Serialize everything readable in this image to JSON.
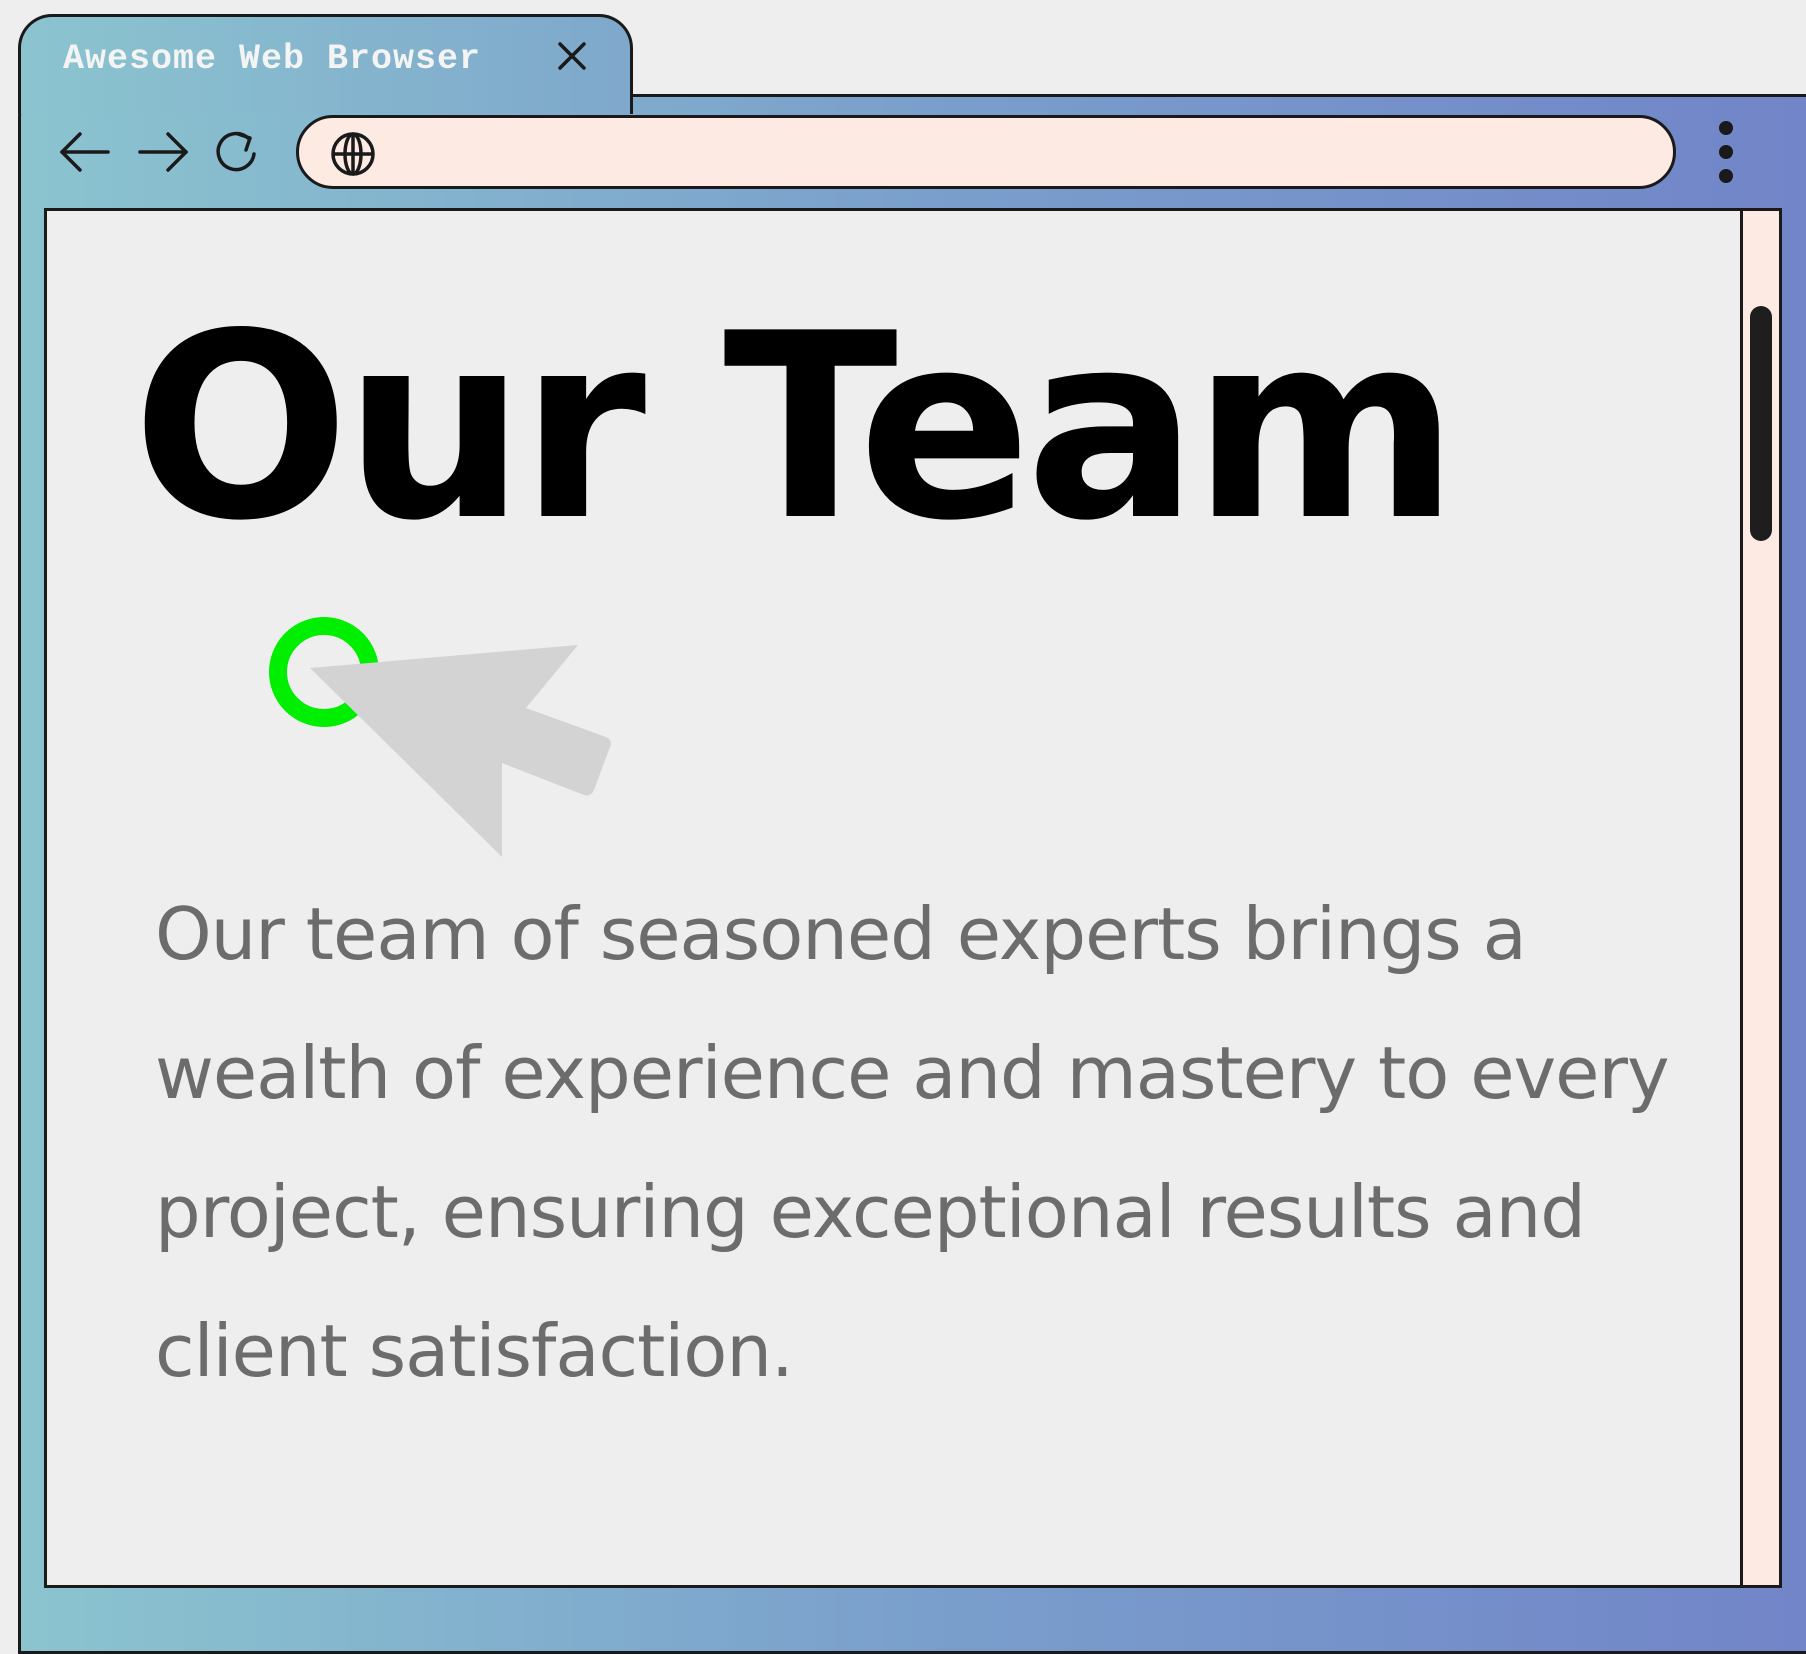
{
  "browser": {
    "tab_title": "Awesome Web Browser",
    "address": "",
    "icons": {
      "close": "close-icon",
      "back": "arrow-left-icon",
      "forward": "arrow-right-icon",
      "reload": "reload-icon",
      "globe": "globe-icon",
      "menu": "kebab-menu-icon"
    }
  },
  "page": {
    "heading": "Our Team",
    "body": "Our team of seasoned experts brings a wealth of experience and mastery to every project, ensuring exceptional results and client satisfaction."
  },
  "colors": {
    "frame_gradient_start": "#8bc4cf",
    "frame_gradient_end": "#7184c8",
    "address_bar_bg": "#fdebe3",
    "page_bg": "#eeeeee",
    "body_text": "#6c6c6c",
    "click_ring": "#00ee00",
    "cursor": "#d3d3d3"
  }
}
